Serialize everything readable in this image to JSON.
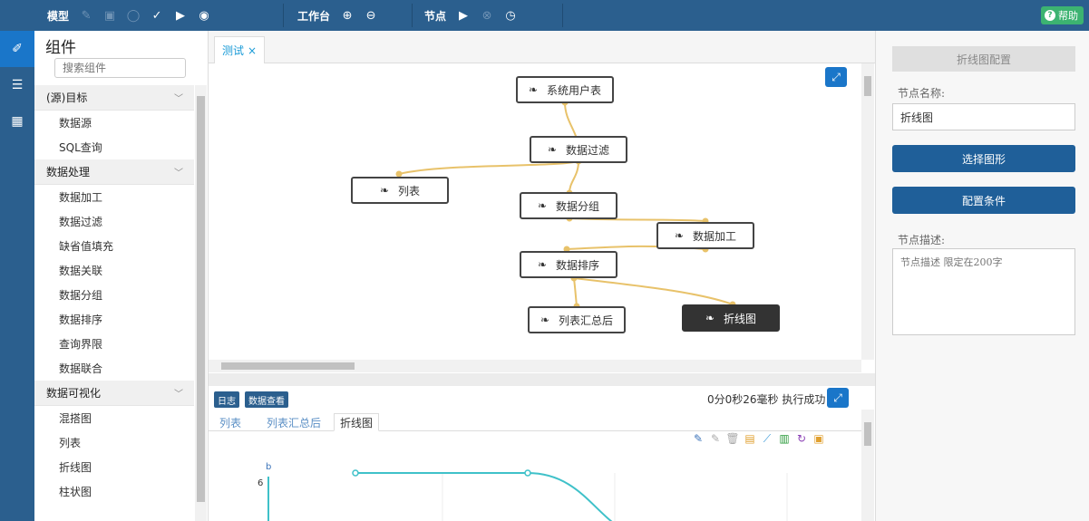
{
  "toolbar": {
    "model_label": "模型",
    "workbench_label": "工作台",
    "node_label": "节点",
    "help_label": "帮助"
  },
  "components": {
    "title": "组件",
    "search_placeholder": "搜索组件",
    "categories": [
      {
        "label": "(源)目标",
        "items": [
          "数据源",
          "SQL查询"
        ]
      },
      {
        "label": "数据处理",
        "items": [
          "数据加工",
          "数据过滤",
          "缺省值填充",
          "数据关联",
          "数据分组",
          "数据排序",
          "查询界限",
          "数据联合"
        ]
      },
      {
        "label": "数据可视化",
        "items": [
          "混搭图",
          "列表",
          "折线图",
          "柱状图"
        ]
      }
    ]
  },
  "tab": {
    "label": "测试",
    "close": "×"
  },
  "nodes": {
    "sys_user": "系统用户表",
    "filter": "数据过滤",
    "list": "列表",
    "group": "数据分组",
    "process": "数据加工",
    "sort": "数据排序",
    "list_summary": "列表汇总后",
    "line_chart": "折线图"
  },
  "bottom": {
    "log_btn": "日志",
    "data_btn": "数据查看",
    "status": "0分0秒26毫秒 执行成功",
    "tabs": [
      "列表",
      "列表汇总后",
      "折线图"
    ],
    "active_tab": "折线图"
  },
  "chart_data": {
    "type": "line",
    "ylabel": "b",
    "y_tick": "6",
    "series": [
      {
        "values": [
          6,
          6
        ]
      }
    ]
  },
  "config": {
    "title": "折线图配置",
    "node_name_label": "节点名称:",
    "node_name_value": "折线图",
    "select_shape_btn": "选择图形",
    "config_cond_btn": "配置条件",
    "node_desc_label": "节点描述:",
    "node_desc_placeholder": "节点描述 限定在200字"
  },
  "colors": {
    "toolbar_bg": "#2b5f8e",
    "primary_btn": "#1f5f99",
    "edge": "#e8c26a",
    "chart_line": "#3fc1c9",
    "help_green": "#3cb371"
  }
}
